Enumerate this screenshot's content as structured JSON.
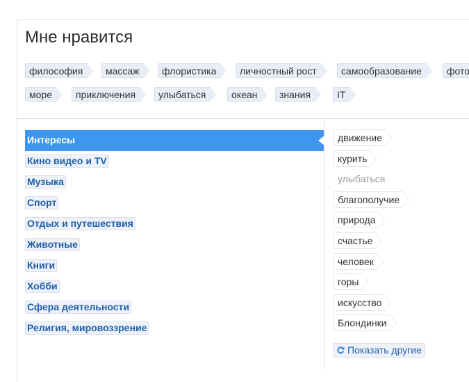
{
  "header": {
    "title": "Мне нравится"
  },
  "top_tags": {
    "row1": [
      "философия",
      "массаж",
      "флористика",
      "личностный рост",
      "самообразование",
      "фото"
    ],
    "row2": [
      "море",
      "приключения",
      "улыбаться",
      "океан",
      "знания",
      "IT"
    ]
  },
  "categories": [
    {
      "label": "Интересы",
      "active": true
    },
    {
      "label": "Кино видео и TV"
    },
    {
      "label": "Музыка"
    },
    {
      "label": "Спорт"
    },
    {
      "label": "Отдых и путешествия"
    },
    {
      "label": "Животные"
    },
    {
      "label": "Книги"
    },
    {
      "label": "Хобби"
    },
    {
      "label": "Сфера деятельности"
    },
    {
      "label": "Религия, мировоззрение"
    }
  ],
  "suggestions": [
    {
      "label": "движение"
    },
    {
      "label": "курить"
    },
    {
      "label": "улыбаться",
      "muted": true
    },
    {
      "label": "благополучие"
    },
    {
      "label": "природа"
    },
    {
      "label": "счастье"
    },
    {
      "label": "человек"
    },
    {
      "label": "горы"
    },
    {
      "label": "искусство"
    },
    {
      "label": "Блондинки"
    }
  ],
  "show_more": {
    "label": "Показать другие",
    "icon": "refresh-icon"
  },
  "colors": {
    "accent": "#3d97f2",
    "link": "#1d5fa8",
    "tag_bg": "#e9eef6"
  }
}
